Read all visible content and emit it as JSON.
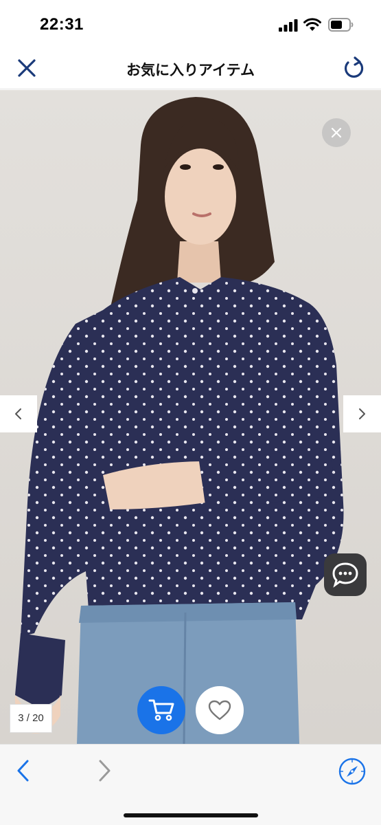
{
  "status_bar": {
    "time": "22:31",
    "icons": [
      "signal-icon",
      "wifi-icon",
      "battery-icon"
    ]
  },
  "header": {
    "title": "お気に入りアイテム",
    "close_icon": "close-icon",
    "reload_icon": "reload-icon",
    "accent_color": "#1a3a7a"
  },
  "product": {
    "image_description_icon": "product-photo",
    "page_indicator": "3 / 20",
    "prev_icon": "chevron-left-icon",
    "next_icon": "chevron-right-icon",
    "dismiss_icon": "close-icon",
    "chat_icon": "chat-bubble-icon",
    "cart_icon": "cart-icon",
    "favorite_icon": "heart-icon",
    "cart_color": "#1a73e8"
  },
  "toolbar": {
    "back_icon": "chevron-left-icon",
    "forward_icon": "chevron-right-icon",
    "safari_icon": "compass-icon",
    "accent_color": "#1a73e8"
  }
}
